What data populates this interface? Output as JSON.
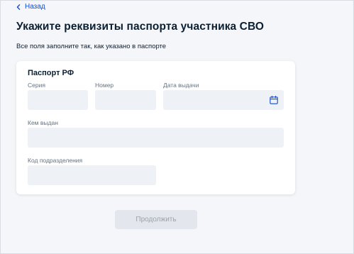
{
  "nav": {
    "back_label": "Назад"
  },
  "header": {
    "title": "Укажите реквизиты паспорта участника СВО",
    "subtitle": "Все поля заполните так, как указано в паспорте"
  },
  "form": {
    "section_title": "Паспорт РФ",
    "fields": {
      "series": {
        "label": "Серия",
        "value": ""
      },
      "number": {
        "label": "Номер",
        "value": ""
      },
      "issue_date": {
        "label": "Дата выдачи",
        "value": "",
        "icon": "calendar-icon"
      },
      "issued_by": {
        "label": "Кем выдан",
        "value": ""
      },
      "division_code": {
        "label": "Код подразделения",
        "value": ""
      }
    }
  },
  "actions": {
    "continue_label": "Продолжить",
    "continue_disabled": true
  },
  "colors": {
    "accent": "#0d4cd3",
    "text": "#0b1f33",
    "muted": "#66727f",
    "input_bg": "#eef1f5",
    "page_bg": "#f5f6f9",
    "button_disabled_bg": "#e3e6ec"
  }
}
